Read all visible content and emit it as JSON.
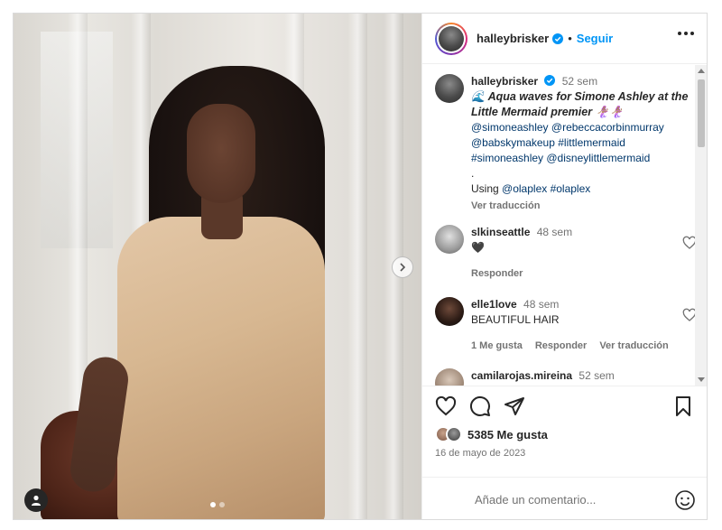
{
  "post": {
    "username": "halleybrisker",
    "separator": "•",
    "follow_label": "Seguir"
  },
  "caption": {
    "username": "halleybrisker",
    "time": "52 sem",
    "title": "🌊 Aqua waves for Simone Ashley at the Little Mermaid premier 🧜🏽‍♀️🧜🏽‍♀️",
    "tags_line1": "@simoneashley @rebeccacorbinmurray",
    "tags_line2": "@babskymakeup #littlemermaid",
    "tags_line3": "#simoneashley @disneylittlemermaid",
    "dot_line": ".",
    "using_prefix": "Using",
    "using_tags": "@olaplex #olaplex",
    "translate": "Ver traducción"
  },
  "comments": [
    {
      "username": "slkinseattle",
      "time": "48 sem",
      "text": "🖤",
      "reply": "Responder"
    },
    {
      "username": "elle1love",
      "time": "48 sem",
      "text": "BEAUTIFUL HAIR",
      "likes": "1 Me gusta",
      "reply": "Responder",
      "translate": "Ver traducción"
    },
    {
      "username": "camilarojas.mireina",
      "time": "52 sem"
    }
  ],
  "stats": {
    "likes": "5385 Me gusta",
    "date": "16 de mayo de 2023"
  },
  "composer": {
    "placeholder": "Añade un comentario..."
  },
  "icons": {
    "verified": "verified-badge-icon",
    "more": "more-options-icon",
    "like": "heart-icon",
    "comment": "comment-icon",
    "share": "share-icon",
    "save": "bookmark-icon",
    "emoji": "emoji-icon",
    "next": "chevron-right-icon",
    "tag": "user-tag-icon"
  },
  "colors": {
    "accent": "#0095f6",
    "verified": "#0095f6",
    "text": "#262626",
    "muted": "#737373"
  }
}
